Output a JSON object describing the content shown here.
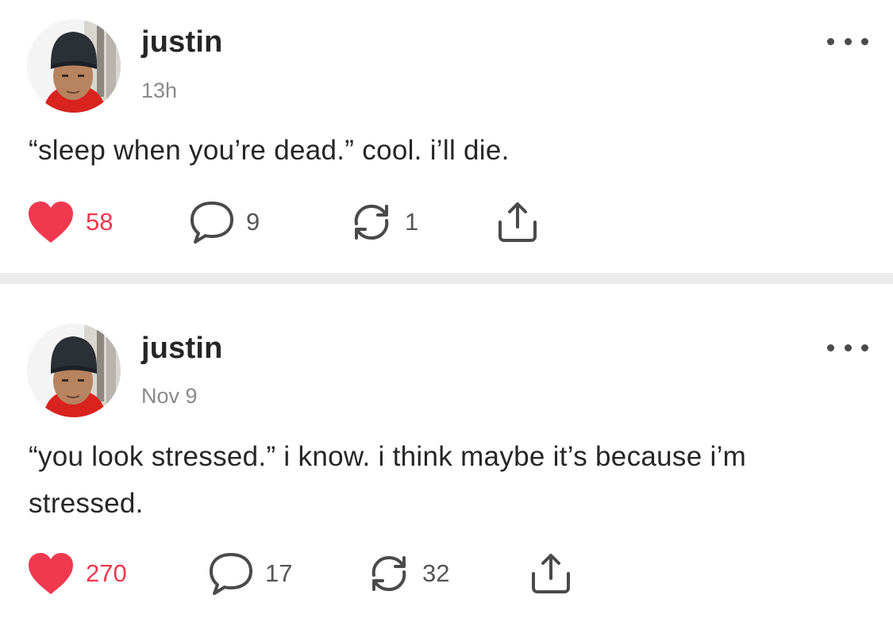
{
  "accent_color": "#f0394f",
  "posts": [
    {
      "username": "justin",
      "timestamp": "13h",
      "text": "“sleep when you’re dead.” cool. i’ll die.",
      "liked": true,
      "likes": "58",
      "comments": "9",
      "reposts": "1",
      "icons": [
        "heart-icon",
        "comment-icon",
        "repost-icon",
        "share-icon",
        "more-icon"
      ]
    },
    {
      "username": "justin",
      "timestamp": "Nov 9",
      "text": "“you look stressed.” i know. i think maybe it’s because i’m stressed.",
      "liked": true,
      "likes": "270",
      "comments": "17",
      "reposts": "32",
      "icons": [
        "heart-icon",
        "comment-icon",
        "repost-icon",
        "share-icon",
        "more-icon"
      ]
    }
  ]
}
